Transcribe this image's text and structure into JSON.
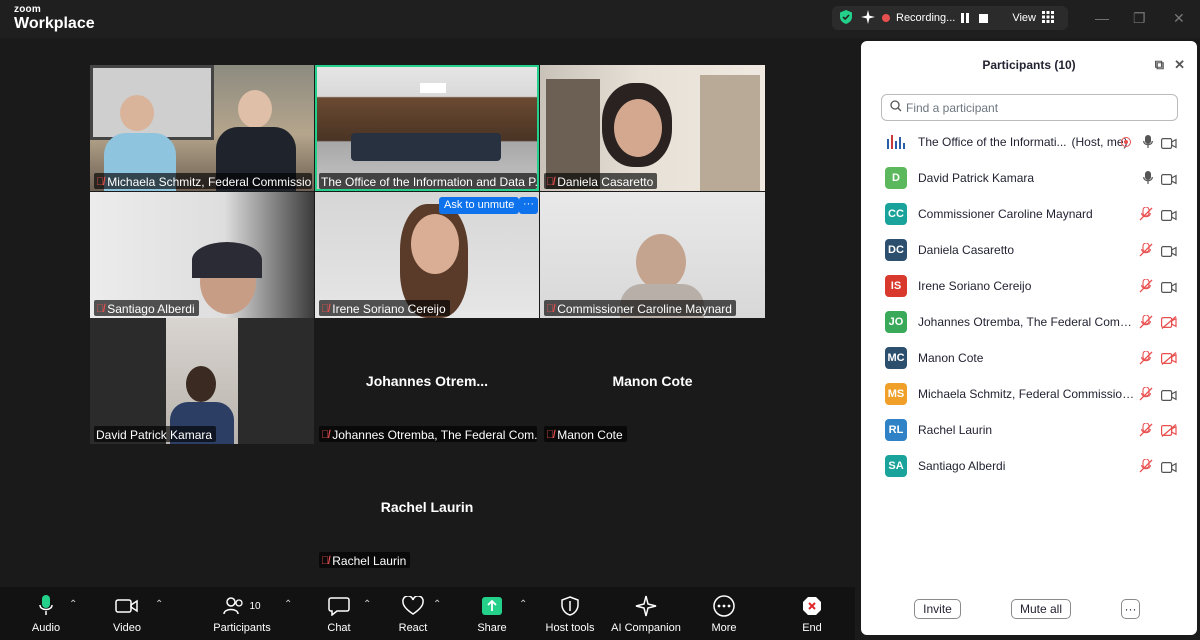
{
  "app": {
    "brand_line1": "zoom",
    "brand_line2": "Workplace"
  },
  "topbar": {
    "recording_label": "Recording...",
    "view_label": "View"
  },
  "tiles": [
    {
      "label": "Michaela Schmitz, Federal Commissio..."
    },
    {
      "label": "The Office of the Information and Data P..."
    },
    {
      "label": "Daniela Casaretto"
    },
    {
      "label": "Santiago Alberdi"
    },
    {
      "label": "Irene Soriano Cereijo"
    },
    {
      "label": "Commissioner Caroline Maynard"
    },
    {
      "label": "David Patrick Kamara"
    },
    {
      "label": "Johannes Otremba, The Federal Com...",
      "center": "Johannes  Otrem..."
    },
    {
      "label": "Manon Cote",
      "center": "Manon Cote"
    },
    {
      "label": "Rachel Laurin",
      "center": "Rachel Laurin"
    }
  ],
  "ask_unmute": "Ask to unmute",
  "ask_unmute_more": "···",
  "toolbar": {
    "audio": "Audio",
    "video": "Video",
    "participants": "Participants",
    "participants_count": "10",
    "chat": "Chat",
    "react": "React",
    "share": "Share",
    "host_tools": "Host tools",
    "ai_companion": "AI Companion",
    "more": "More",
    "end": "End"
  },
  "panel": {
    "title": "Participants (10)",
    "search_placeholder": "Find a participant",
    "participants": [
      {
        "name": "The Office of the Informati...",
        "suffix": "(Host, me)",
        "initials": "",
        "color": "#ffffff",
        "mic": "on",
        "video": "on"
      },
      {
        "name": "David Patrick Kamara",
        "initials": "D",
        "color": "#5cb85c",
        "mic": "on",
        "video": "on"
      },
      {
        "name": "Commissioner Caroline Maynard",
        "initials": "CC",
        "color": "#1aa39a",
        "mic": "off",
        "video": "on"
      },
      {
        "name": "Daniela Casaretto",
        "initials": "DC",
        "color": "#2d4f6e",
        "mic": "off",
        "video": "on"
      },
      {
        "name": "Irene Soriano Cereijo",
        "initials": "IS",
        "color": "#d9392c",
        "mic": "off",
        "video": "on"
      },
      {
        "name": "Johannes Otremba, The Federal Commiss...",
        "initials": "JO",
        "color": "#3aaa5a",
        "mic": "off",
        "video": "off"
      },
      {
        "name": "Manon Cote",
        "initials": "MC",
        "color": "#2d4f6e",
        "mic": "off",
        "video": "off"
      },
      {
        "name": "Michaela Schmitz, Federal Commissioner",
        "initials": "MS",
        "color": "#f0a028",
        "mic": "off",
        "video": "on"
      },
      {
        "name": "Rachel Laurin",
        "initials": "RL",
        "color": "#2f82c5",
        "mic": "off",
        "video": "off"
      },
      {
        "name": "Santiago Alberdi",
        "initials": "SA",
        "color": "#1aa39a",
        "mic": "off",
        "video": "on"
      }
    ],
    "invite": "Invite",
    "mute_all": "Mute all",
    "more": "···"
  }
}
